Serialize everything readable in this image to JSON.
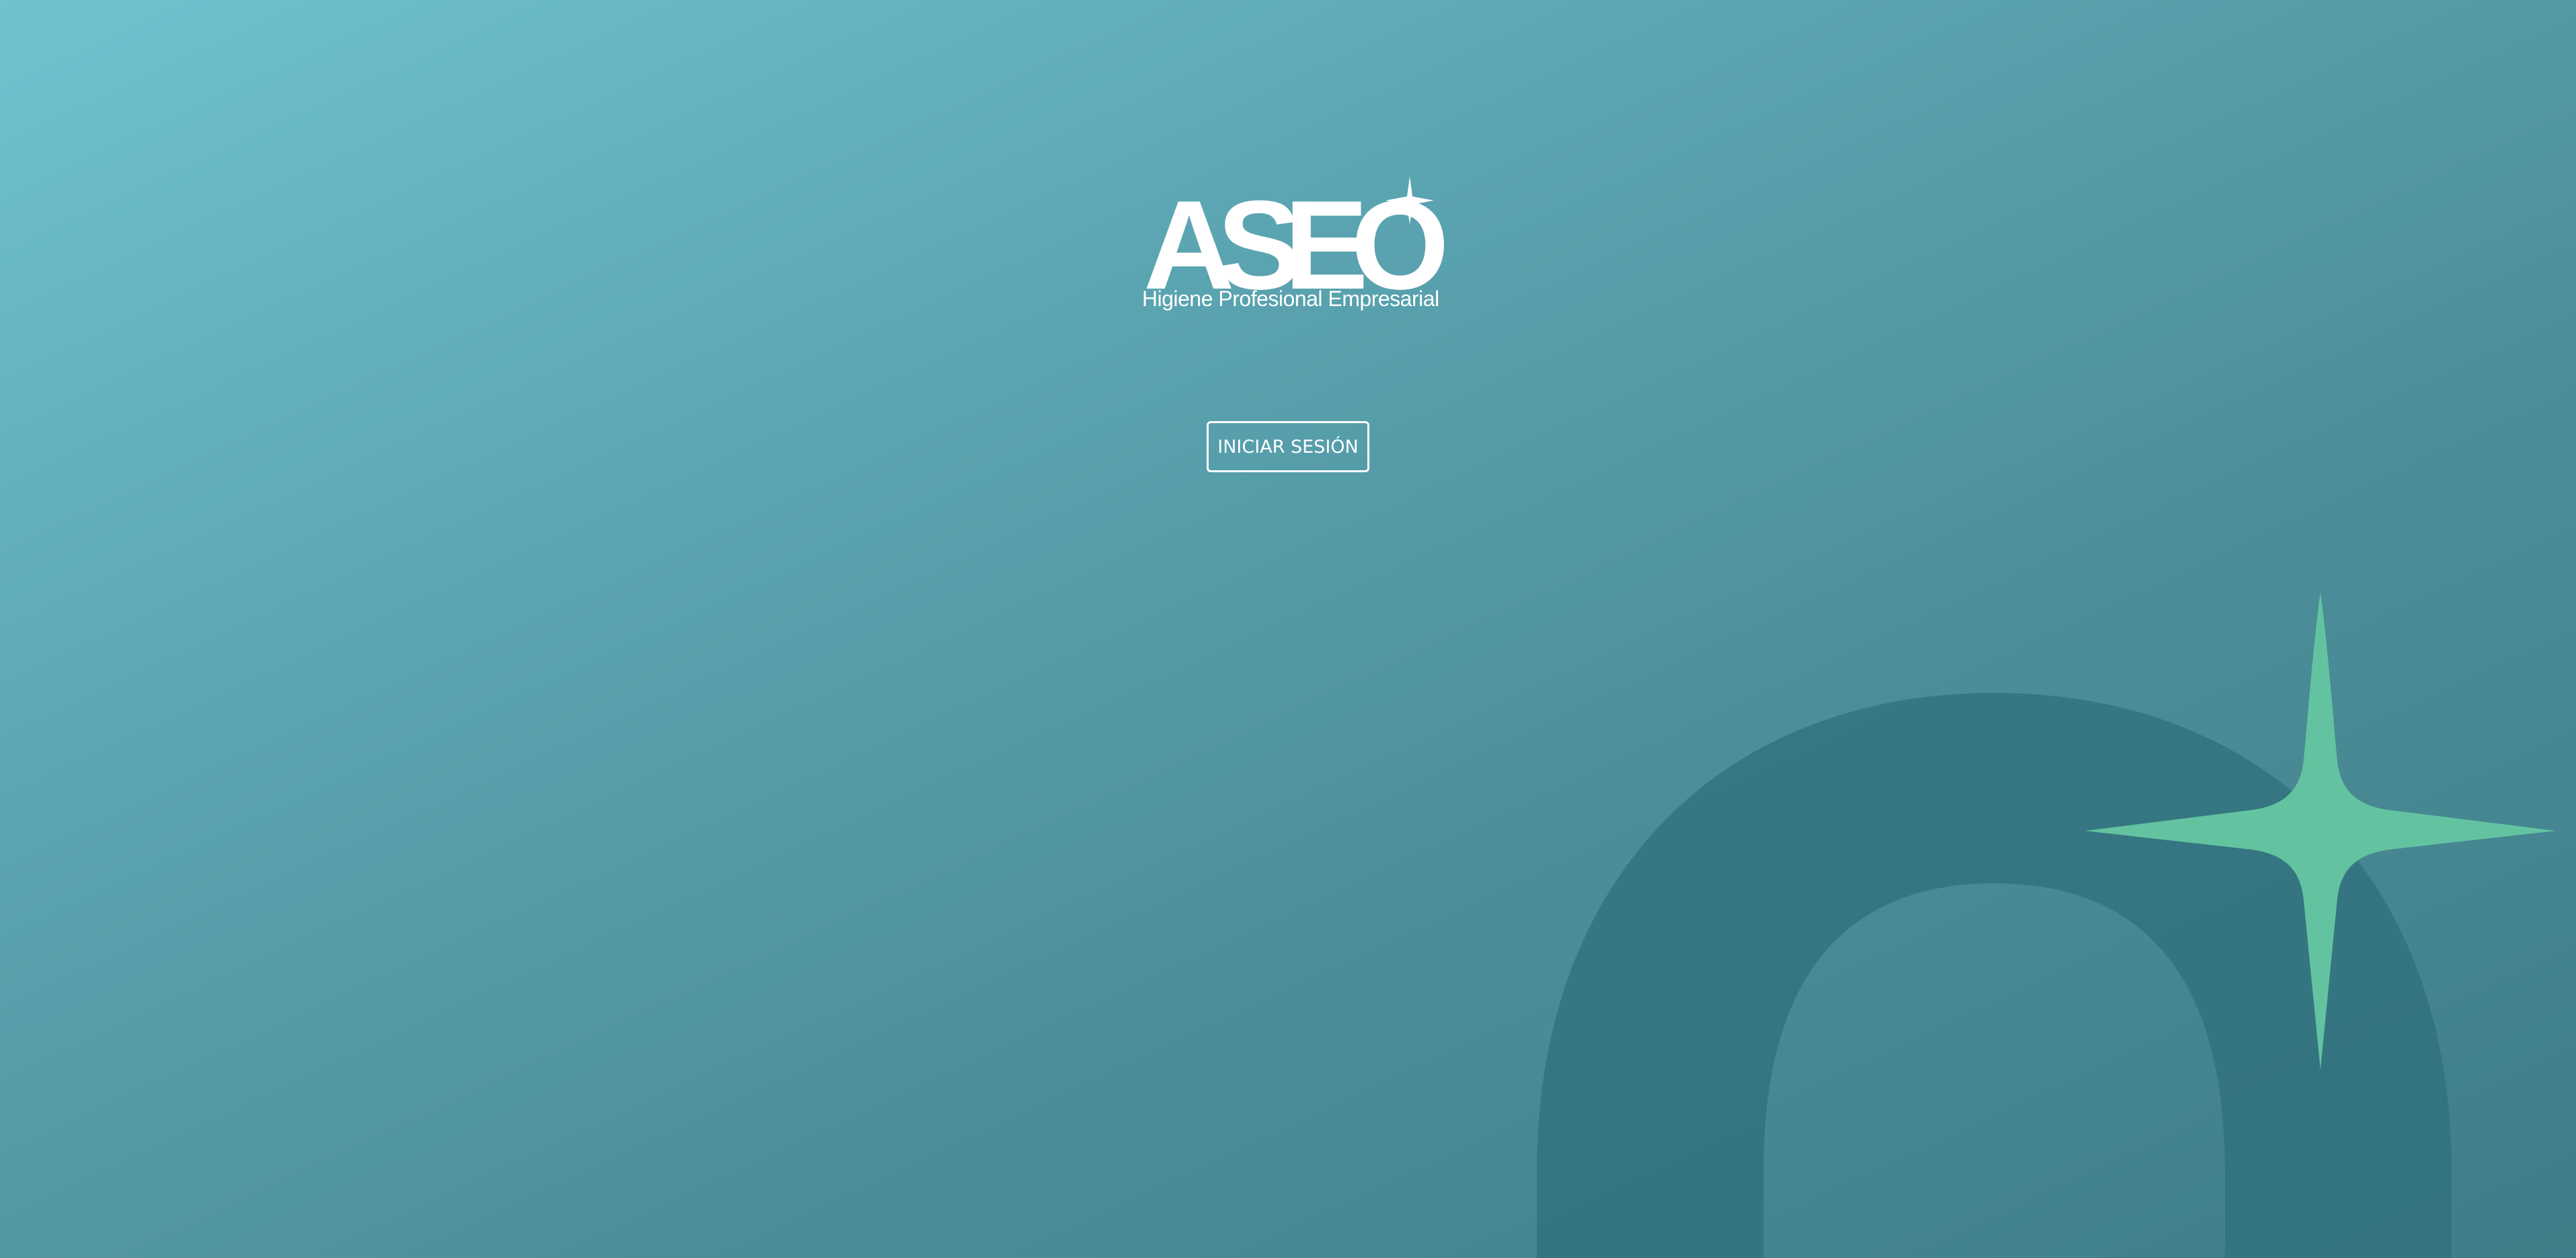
{
  "brand": {
    "logo_text": "ASEO",
    "tagline": "Higiene Profesional Empresarial"
  },
  "actions": {
    "login_label": "INICIAR SESIÓN"
  },
  "colors": {
    "background_top": "#6fc3cf",
    "background_bottom": "#3f7d88",
    "decorative_o": "#2f6f7b",
    "sparkle_accent": "#63c3a0",
    "foreground": "#ffffff"
  }
}
